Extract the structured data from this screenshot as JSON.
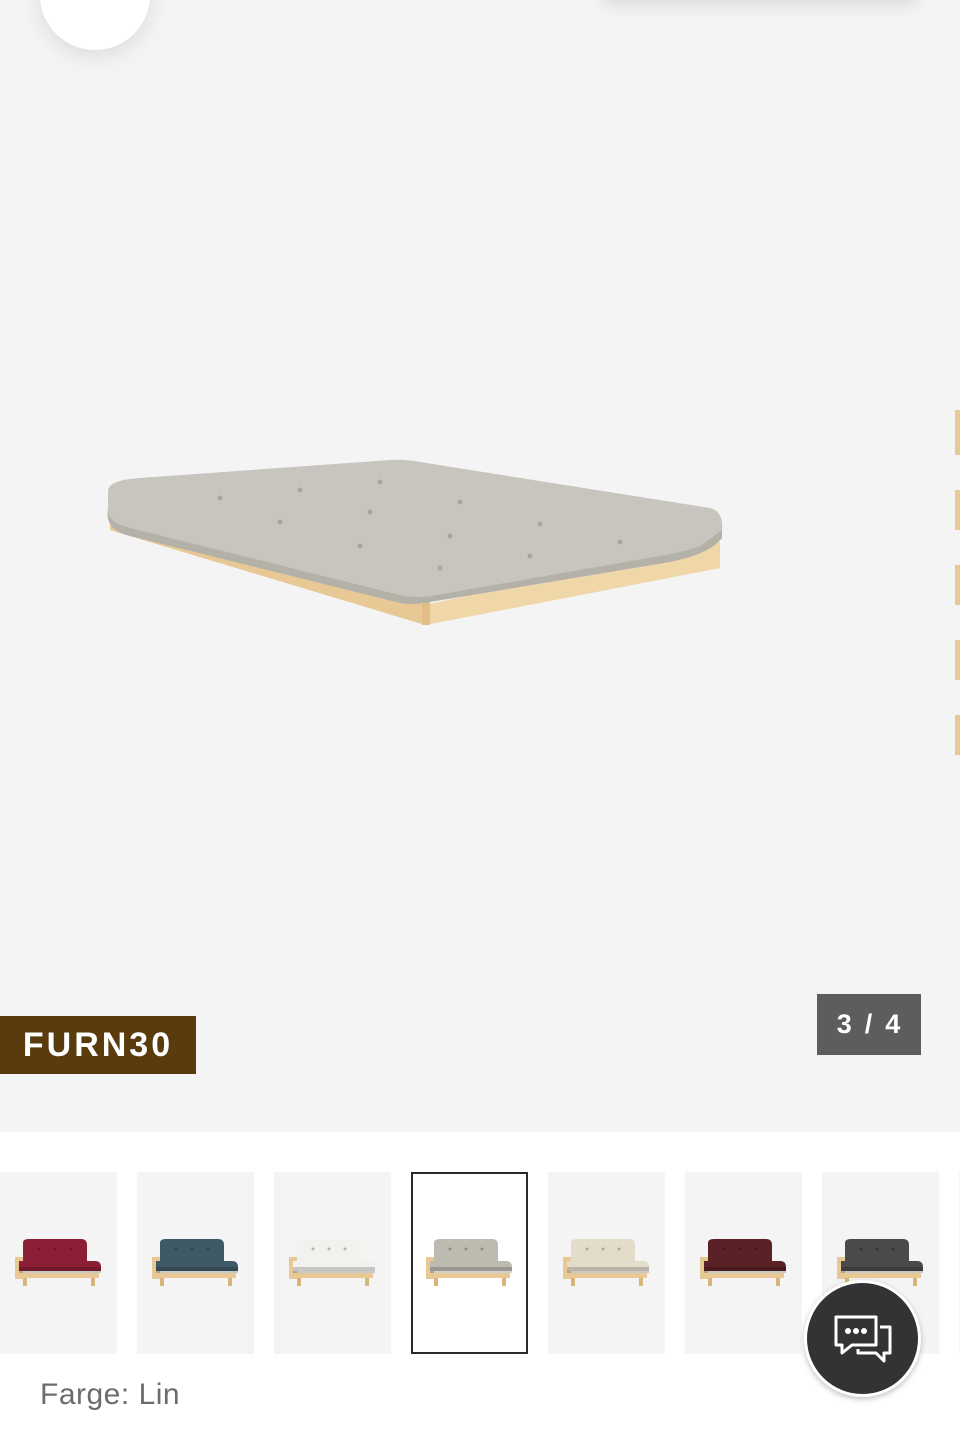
{
  "gallery": {
    "promo_code": "FURN30",
    "counter": {
      "current": "3",
      "separator": "/",
      "total": "4"
    }
  },
  "variants": {
    "selected_index": 3,
    "items": [
      {
        "color": "#8c1f35",
        "name": "thumb-bordeaux"
      },
      {
        "color": "#3d5a66",
        "name": "thumb-petrol"
      },
      {
        "color": "#f2f1ee",
        "name": "thumb-white"
      },
      {
        "color": "#bdbab0",
        "name": "thumb-linen"
      },
      {
        "color": "#e4dccb",
        "name": "thumb-beige"
      },
      {
        "color": "#5a2227",
        "name": "thumb-wine"
      },
      {
        "color": "#4a4a4a",
        "name": "thumb-grey"
      }
    ]
  },
  "selection": {
    "label": "Farge:",
    "value": "Lin"
  },
  "chat": {
    "icon": "chat-bubbles-icon"
  }
}
